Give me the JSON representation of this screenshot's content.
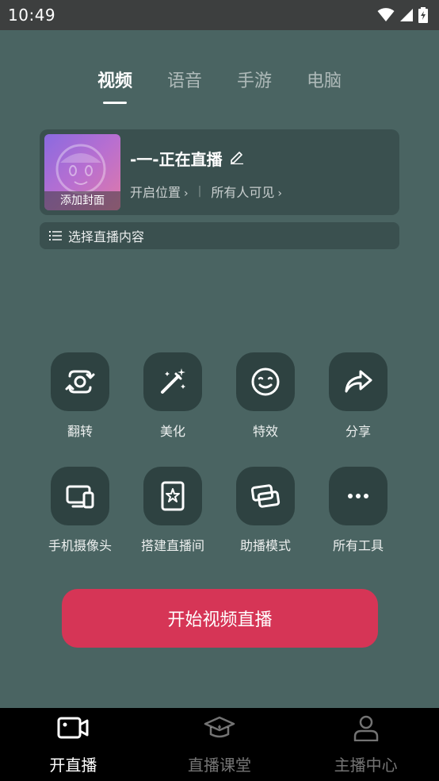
{
  "status_bar": {
    "time": "10:49",
    "icons": [
      "wifi-icon",
      "signal-icon",
      "battery-icon"
    ]
  },
  "tabs": [
    {
      "label": "视频",
      "active": true
    },
    {
      "label": "语音",
      "active": false
    },
    {
      "label": "手游",
      "active": false
    },
    {
      "label": "电脑",
      "active": false
    }
  ],
  "info_card": {
    "cover_label": "添加封面",
    "title": "-一-正在直播",
    "location": "开启位置",
    "visibility": "所有人可见"
  },
  "select_content": {
    "label": "选择直播内容"
  },
  "tools": [
    {
      "label": "翻转",
      "icon": "camera-flip-icon"
    },
    {
      "label": "美化",
      "icon": "magic-wand-icon"
    },
    {
      "label": "特效",
      "icon": "face-effect-icon"
    },
    {
      "label": "分享",
      "icon": "share-icon"
    },
    {
      "label": "手机摄像头",
      "icon": "phone-camera-icon"
    },
    {
      "label": "搭建直播间",
      "icon": "room-setup-icon"
    },
    {
      "label": "助播模式",
      "icon": "assist-mode-icon"
    },
    {
      "label": "所有工具",
      "icon": "more-icon"
    }
  ],
  "start_button": {
    "label": "开始视频直播",
    "color": "#d63556"
  },
  "bottom_nav": [
    {
      "label": "开直播",
      "icon": "video-camera-icon",
      "active": true
    },
    {
      "label": "直播课堂",
      "icon": "graduation-cap-icon",
      "active": false
    },
    {
      "label": "主播中心",
      "icon": "person-icon",
      "active": false
    }
  ],
  "colors": {
    "background": "#4a6462",
    "card": "#3a504f",
    "tool_button": "#2e4241",
    "accent": "#d63556"
  }
}
